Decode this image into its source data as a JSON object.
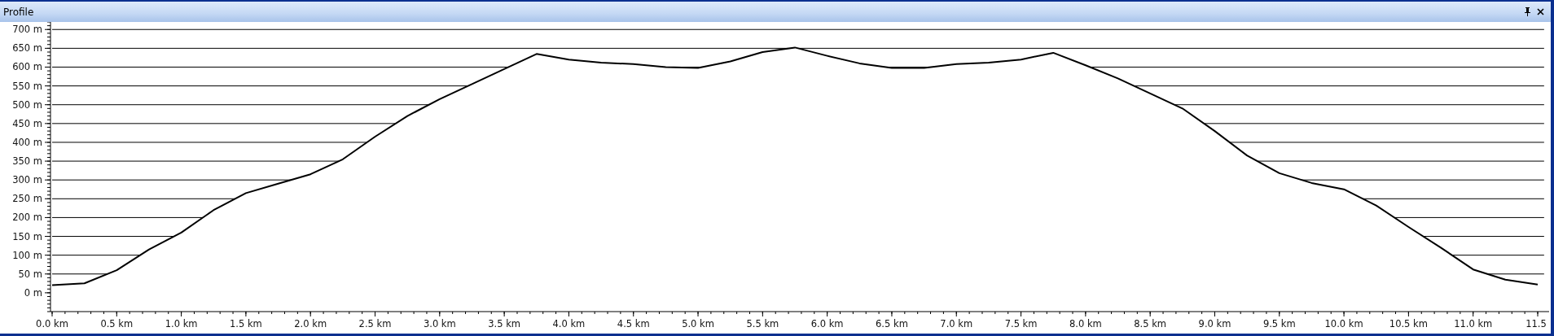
{
  "window": {
    "title": "Profile"
  },
  "chart": {
    "chart_data": {
      "type": "line",
      "grid": true,
      "xlim": [
        0,
        11.55
      ],
      "ylim": [
        -50,
        720
      ],
      "x": [
        0,
        0.25,
        0.5,
        0.75,
        1,
        1.25,
        1.5,
        1.75,
        2,
        2.25,
        2.5,
        2.75,
        3,
        3.25,
        3.5,
        3.75,
        4,
        4.25,
        4.5,
        4.75,
        5,
        5.25,
        5.5,
        5.75,
        6,
        6.25,
        6.5,
        6.75,
        7,
        7.25,
        7.5,
        7.75,
        8,
        8.25,
        8.5,
        8.75,
        9,
        9.25,
        9.5,
        9.75,
        10,
        10.25,
        10.5,
        10.75,
        11,
        11.25,
        11.5
      ],
      "series": [
        {
          "color": "#000000",
          "values": [
            20,
            25,
            60,
            115,
            160,
            220,
            265,
            290,
            315,
            355,
            415,
            470,
            515,
            555,
            595,
            635,
            620,
            612,
            608,
            600,
            598,
            615,
            640,
            652,
            630,
            610,
            598,
            598,
            608,
            612,
            620,
            638,
            605,
            570,
            530,
            490,
            430,
            365,
            318,
            292,
            275,
            232,
            175,
            120,
            62,
            35,
            22
          ]
        }
      ],
      "yticks": [
        {
          "value": 0,
          "label": "0 m"
        },
        {
          "value": 50,
          "label": "50 m"
        },
        {
          "value": 100,
          "label": "100 m"
        },
        {
          "value": 150,
          "label": "150 m"
        },
        {
          "value": 200,
          "label": "200 m"
        },
        {
          "value": 250,
          "label": "250 m"
        },
        {
          "value": 300,
          "label": "300 m"
        },
        {
          "value": 350,
          "label": "350 m"
        },
        {
          "value": 400,
          "label": "400 m"
        },
        {
          "value": 450,
          "label": "450 m"
        },
        {
          "value": 500,
          "label": "500 m"
        },
        {
          "value": 550,
          "label": "550 m"
        },
        {
          "value": 600,
          "label": "600 m"
        },
        {
          "value": 650,
          "label": "650 m"
        },
        {
          "value": 700,
          "label": "700 m"
        }
      ],
      "xticks": [
        {
          "value": 0,
          "label": "0.0 km"
        },
        {
          "value": 0.5,
          "label": "0.5 km"
        },
        {
          "value": 1,
          "label": "1.0 km"
        },
        {
          "value": 1.5,
          "label": "1.5 km"
        },
        {
          "value": 2,
          "label": "2.0 km"
        },
        {
          "value": 2.5,
          "label": "2.5 km"
        },
        {
          "value": 3,
          "label": "3.0 km"
        },
        {
          "value": 3.5,
          "label": "3.5 km"
        },
        {
          "value": 4,
          "label": "4.0 km"
        },
        {
          "value": 4.5,
          "label": "4.5 km"
        },
        {
          "value": 5,
          "label": "5.0 km"
        },
        {
          "value": 5.5,
          "label": "5.5 km"
        },
        {
          "value": 6,
          "label": "6.0 km"
        },
        {
          "value": 6.5,
          "label": "6.5 km"
        },
        {
          "value": 7,
          "label": "7.0 km"
        },
        {
          "value": 7.5,
          "label": "7.5 km"
        },
        {
          "value": 8,
          "label": "8.0 km"
        },
        {
          "value": 8.5,
          "label": "8.5 km"
        },
        {
          "value": 9,
          "label": "9.0 km"
        },
        {
          "value": 9.5,
          "label": "9.5 km"
        },
        {
          "value": 10,
          "label": "10.0 km"
        },
        {
          "value": 10.5,
          "label": "10.5 km"
        },
        {
          "value": 11,
          "label": "11.0 km"
        },
        {
          "value": 11.5,
          "label": "11.5"
        }
      ]
    }
  }
}
